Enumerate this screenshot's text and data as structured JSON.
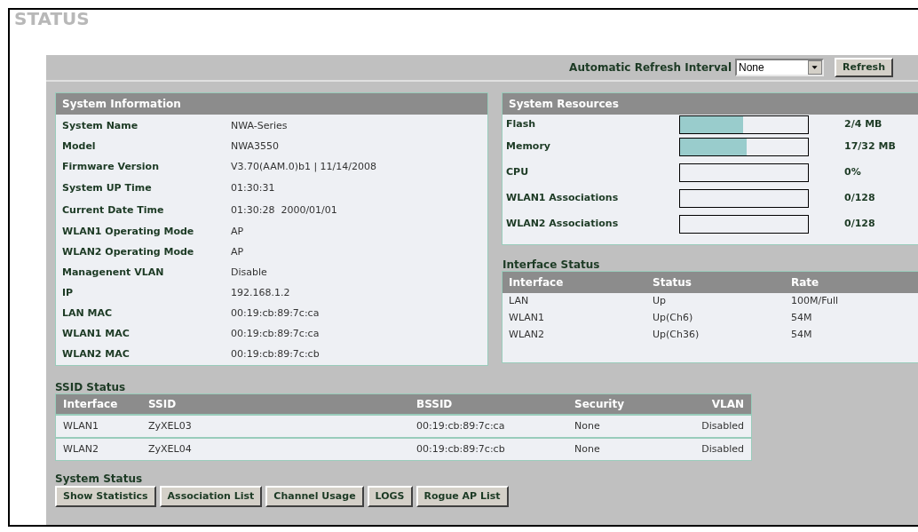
{
  "page_title": "STATUS",
  "refresh": {
    "label": "Automatic Refresh Interval",
    "value": "None",
    "button": "Refresh"
  },
  "system_information": {
    "title": "System Information",
    "rows": [
      {
        "label": "System Name",
        "value": "NWA-Series"
      },
      {
        "label": "Model",
        "value": "NWA3550"
      },
      {
        "label": "Firmware Version",
        "value": "V3.70(AAM.0)b1 | 11/14/2008"
      },
      {
        "label": "System UP Time",
        "value": "01:30:31"
      },
      {
        "label": "Current Date Time",
        "value": "01:30:28  2000/01/01"
      },
      {
        "label": "WLAN1 Operating Mode",
        "value": "AP"
      },
      {
        "label": "WLAN2 Operating Mode",
        "value": "AP"
      },
      {
        "label": "Managenent VLAN",
        "value": "Disable"
      },
      {
        "label": "IP",
        "value": "192.168.1.2"
      },
      {
        "label": "LAN MAC",
        "value": "00:19:cb:89:7c:ca"
      },
      {
        "label": "WLAN1 MAC",
        "value": "00:19:cb:89:7c:ca"
      },
      {
        "label": "WLAN2 MAC",
        "value": "00:19:cb:89:7c:cb"
      }
    ]
  },
  "system_resources": {
    "title": "System Resources",
    "rows": [
      {
        "label": "Flash",
        "level": 0.49,
        "reading": "2/4 MB"
      },
      {
        "label": "Memory",
        "level": 0.52,
        "reading": "17/32 MB"
      },
      {
        "label": "CPU",
        "level": 0,
        "reading": "0%"
      },
      {
        "label": "WLAN1 Associations",
        "level": 0,
        "reading": "0/128"
      },
      {
        "label": "WLAN2 Associations",
        "level": 0,
        "reading": "0/128"
      }
    ]
  },
  "interface_status": {
    "title": "Interface Status",
    "columns": [
      "Interface",
      "Status",
      "Rate"
    ],
    "rows": [
      [
        "LAN",
        "Up",
        "100M/Full"
      ],
      [
        "WLAN1",
        "Up(Ch6)",
        "54M"
      ],
      [
        "WLAN2",
        "Up(Ch36)",
        "54M"
      ]
    ]
  },
  "ssid_status": {
    "title": "SSID Status",
    "columns": [
      "Interface",
      "SSID",
      "BSSID",
      "Security",
      "VLAN"
    ],
    "rows": [
      [
        "WLAN1",
        "ZyXEL03",
        "00:19:cb:89:7c:ca",
        "None",
        "Disabled"
      ],
      [
        "WLAN2",
        "ZyXEL04",
        "00:19:cb:89:7c:cb",
        "None",
        "Disabled"
      ]
    ]
  },
  "system_status": {
    "title": "System Status",
    "buttons": [
      "Show Statistics",
      "Association List",
      "Channel Usage",
      "LOGS",
      "Rogue AP List"
    ]
  }
}
